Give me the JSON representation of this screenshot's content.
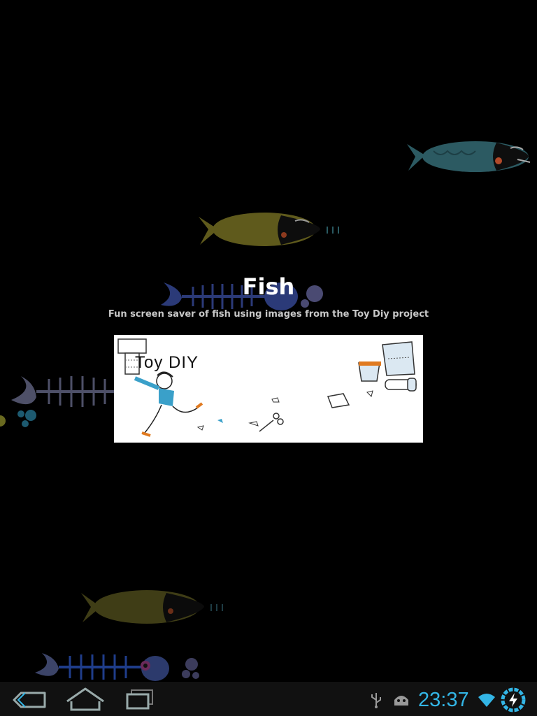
{
  "preview": {
    "title": "Fish",
    "subtitle": "Fun screen saver of fish using images from the Toy Diy project",
    "banner_logo": "Toy DIY"
  },
  "system_bar": {
    "time": "23:37",
    "back_icon": "back-icon",
    "home_icon": "home-icon",
    "recents_icon": "recent-apps-icon",
    "status_icons": [
      "usb-icon",
      "android-debug-icon",
      "wifi-icon",
      "battery-charging-icon"
    ]
  },
  "colors": {
    "clock": "#33b5e5",
    "background": "#000000"
  }
}
